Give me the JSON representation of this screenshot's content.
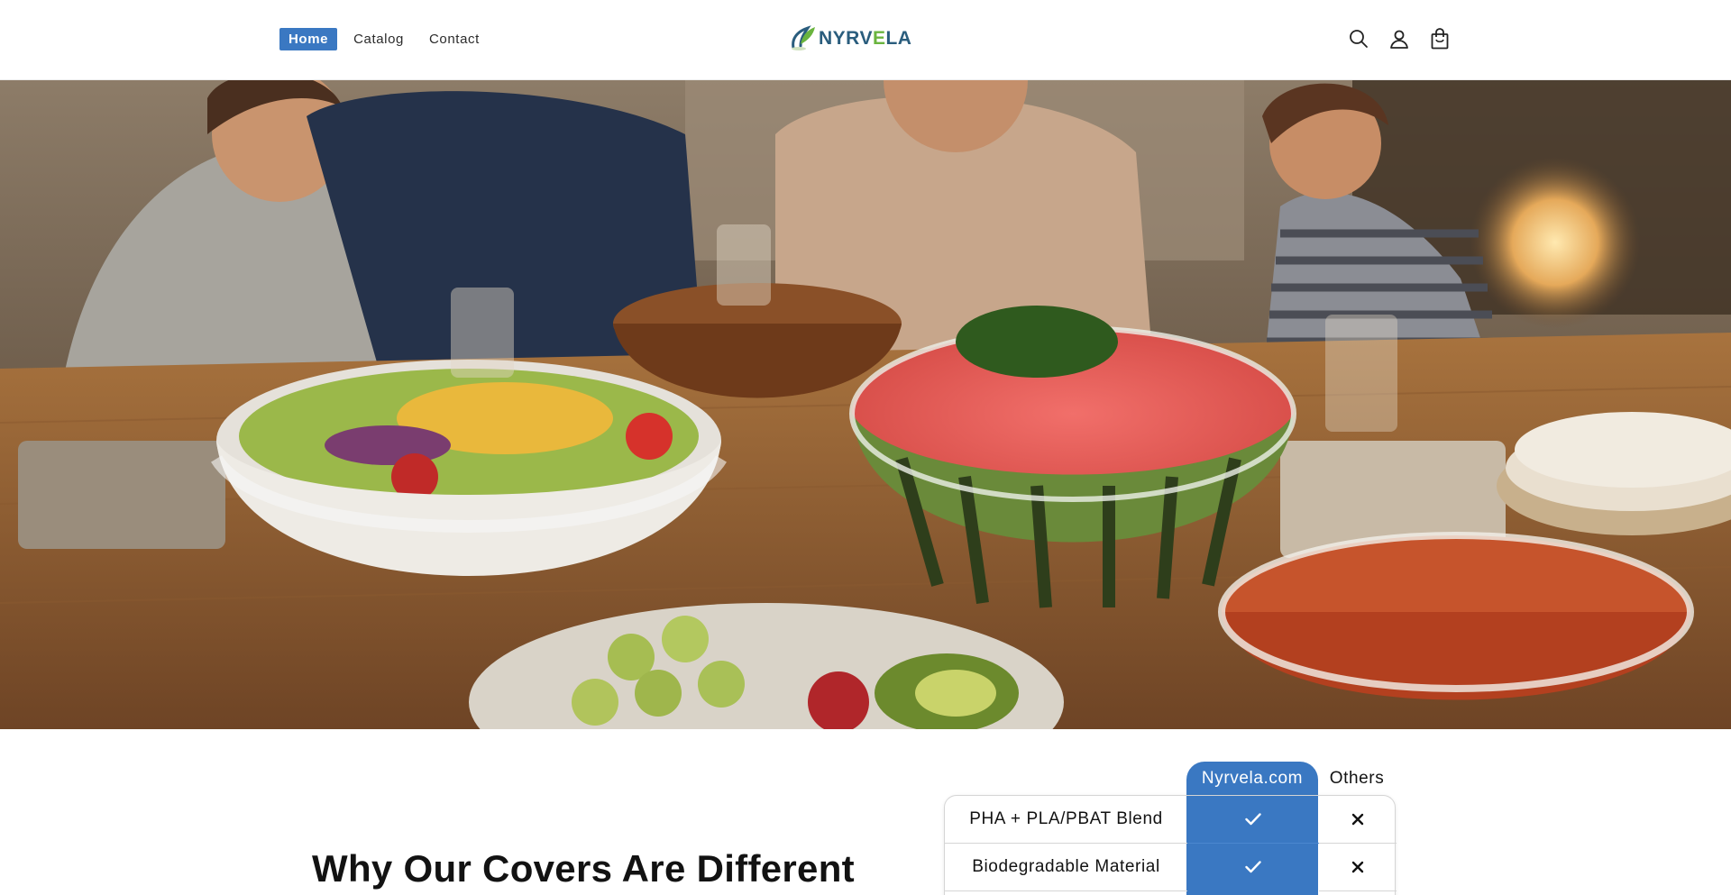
{
  "header": {
    "nav": [
      {
        "label": "Home",
        "active": true
      },
      {
        "label": "Catalog",
        "active": false
      },
      {
        "label": "Contact",
        "active": false
      }
    ],
    "logo": {
      "text_part1": "NYRV",
      "text_part2": "E",
      "text_part3": "LA"
    },
    "icons": [
      "search-icon",
      "account-icon",
      "cart-icon"
    ]
  },
  "hero": {
    "image": "family-dinner-table-with-covered-bowls"
  },
  "section": {
    "title": "Why Our Covers Are Different"
  },
  "comparison": {
    "ours_label": "Nyrvela.com",
    "others_label": "Others",
    "rows": [
      {
        "feature": "PHA + PLA/PBAT Blend",
        "ours": "check-icon",
        "others": "x-icon"
      },
      {
        "feature": "Biodegradable Material",
        "ours": "check-icon",
        "others": "x-icon"
      }
    ]
  },
  "colors": {
    "accent": "#3a78c2",
    "logo_blue": "#2a5d7d",
    "logo_green": "#6ab43e"
  }
}
